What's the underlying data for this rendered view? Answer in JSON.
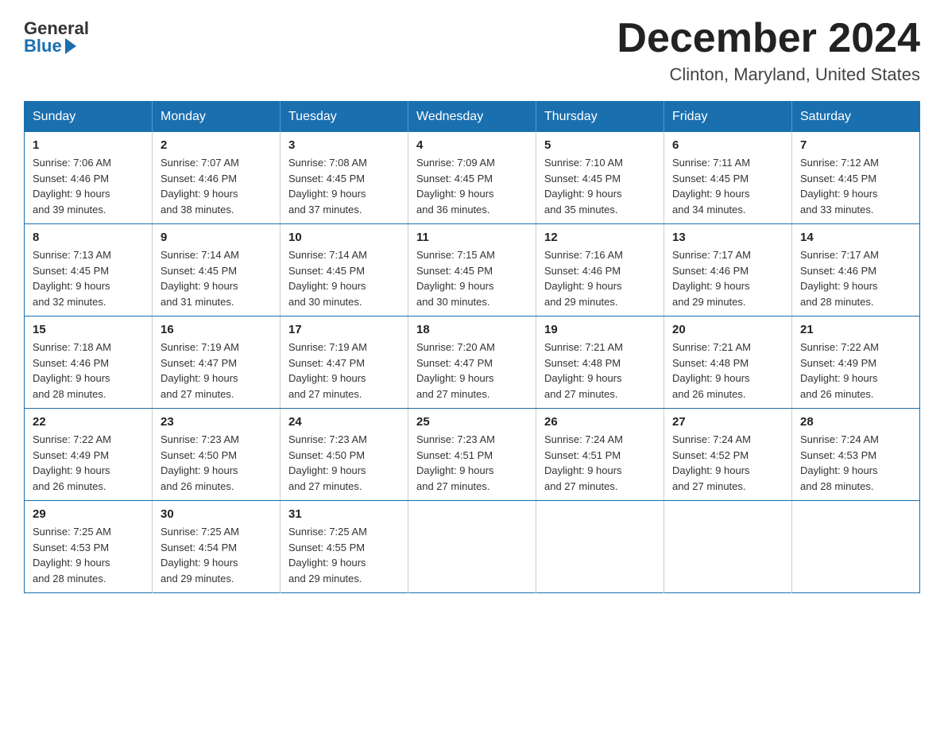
{
  "header": {
    "logo_general": "General",
    "logo_blue": "Blue",
    "month_title": "December 2024",
    "location": "Clinton, Maryland, United States"
  },
  "weekdays": [
    "Sunday",
    "Monday",
    "Tuesday",
    "Wednesday",
    "Thursday",
    "Friday",
    "Saturday"
  ],
  "weeks": [
    [
      {
        "day": "1",
        "sunrise": "7:06 AM",
        "sunset": "4:46 PM",
        "daylight": "9 hours and 39 minutes."
      },
      {
        "day": "2",
        "sunrise": "7:07 AM",
        "sunset": "4:46 PM",
        "daylight": "9 hours and 38 minutes."
      },
      {
        "day": "3",
        "sunrise": "7:08 AM",
        "sunset": "4:45 PM",
        "daylight": "9 hours and 37 minutes."
      },
      {
        "day": "4",
        "sunrise": "7:09 AM",
        "sunset": "4:45 PM",
        "daylight": "9 hours and 36 minutes."
      },
      {
        "day": "5",
        "sunrise": "7:10 AM",
        "sunset": "4:45 PM",
        "daylight": "9 hours and 35 minutes."
      },
      {
        "day": "6",
        "sunrise": "7:11 AM",
        "sunset": "4:45 PM",
        "daylight": "9 hours and 34 minutes."
      },
      {
        "day": "7",
        "sunrise": "7:12 AM",
        "sunset": "4:45 PM",
        "daylight": "9 hours and 33 minutes."
      }
    ],
    [
      {
        "day": "8",
        "sunrise": "7:13 AM",
        "sunset": "4:45 PM",
        "daylight": "9 hours and 32 minutes."
      },
      {
        "day": "9",
        "sunrise": "7:14 AM",
        "sunset": "4:45 PM",
        "daylight": "9 hours and 31 minutes."
      },
      {
        "day": "10",
        "sunrise": "7:14 AM",
        "sunset": "4:45 PM",
        "daylight": "9 hours and 30 minutes."
      },
      {
        "day": "11",
        "sunrise": "7:15 AM",
        "sunset": "4:45 PM",
        "daylight": "9 hours and 30 minutes."
      },
      {
        "day": "12",
        "sunrise": "7:16 AM",
        "sunset": "4:46 PM",
        "daylight": "9 hours and 29 minutes."
      },
      {
        "day": "13",
        "sunrise": "7:17 AM",
        "sunset": "4:46 PM",
        "daylight": "9 hours and 29 minutes."
      },
      {
        "day": "14",
        "sunrise": "7:17 AM",
        "sunset": "4:46 PM",
        "daylight": "9 hours and 28 minutes."
      }
    ],
    [
      {
        "day": "15",
        "sunrise": "7:18 AM",
        "sunset": "4:46 PM",
        "daylight": "9 hours and 28 minutes."
      },
      {
        "day": "16",
        "sunrise": "7:19 AM",
        "sunset": "4:47 PM",
        "daylight": "9 hours and 27 minutes."
      },
      {
        "day": "17",
        "sunrise": "7:19 AM",
        "sunset": "4:47 PM",
        "daylight": "9 hours and 27 minutes."
      },
      {
        "day": "18",
        "sunrise": "7:20 AM",
        "sunset": "4:47 PM",
        "daylight": "9 hours and 27 minutes."
      },
      {
        "day": "19",
        "sunrise": "7:21 AM",
        "sunset": "4:48 PM",
        "daylight": "9 hours and 27 minutes."
      },
      {
        "day": "20",
        "sunrise": "7:21 AM",
        "sunset": "4:48 PM",
        "daylight": "9 hours and 26 minutes."
      },
      {
        "day": "21",
        "sunrise": "7:22 AM",
        "sunset": "4:49 PM",
        "daylight": "9 hours and 26 minutes."
      }
    ],
    [
      {
        "day": "22",
        "sunrise": "7:22 AM",
        "sunset": "4:49 PM",
        "daylight": "9 hours and 26 minutes."
      },
      {
        "day": "23",
        "sunrise": "7:23 AM",
        "sunset": "4:50 PM",
        "daylight": "9 hours and 26 minutes."
      },
      {
        "day": "24",
        "sunrise": "7:23 AM",
        "sunset": "4:50 PM",
        "daylight": "9 hours and 27 minutes."
      },
      {
        "day": "25",
        "sunrise": "7:23 AM",
        "sunset": "4:51 PM",
        "daylight": "9 hours and 27 minutes."
      },
      {
        "day": "26",
        "sunrise": "7:24 AM",
        "sunset": "4:51 PM",
        "daylight": "9 hours and 27 minutes."
      },
      {
        "day": "27",
        "sunrise": "7:24 AM",
        "sunset": "4:52 PM",
        "daylight": "9 hours and 27 minutes."
      },
      {
        "day": "28",
        "sunrise": "7:24 AM",
        "sunset": "4:53 PM",
        "daylight": "9 hours and 28 minutes."
      }
    ],
    [
      {
        "day": "29",
        "sunrise": "7:25 AM",
        "sunset": "4:53 PM",
        "daylight": "9 hours and 28 minutes."
      },
      {
        "day": "30",
        "sunrise": "7:25 AM",
        "sunset": "4:54 PM",
        "daylight": "9 hours and 29 minutes."
      },
      {
        "day": "31",
        "sunrise": "7:25 AM",
        "sunset": "4:55 PM",
        "daylight": "9 hours and 29 minutes."
      },
      null,
      null,
      null,
      null
    ]
  ],
  "labels": {
    "sunrise": "Sunrise:",
    "sunset": "Sunset:",
    "daylight": "Daylight:"
  }
}
